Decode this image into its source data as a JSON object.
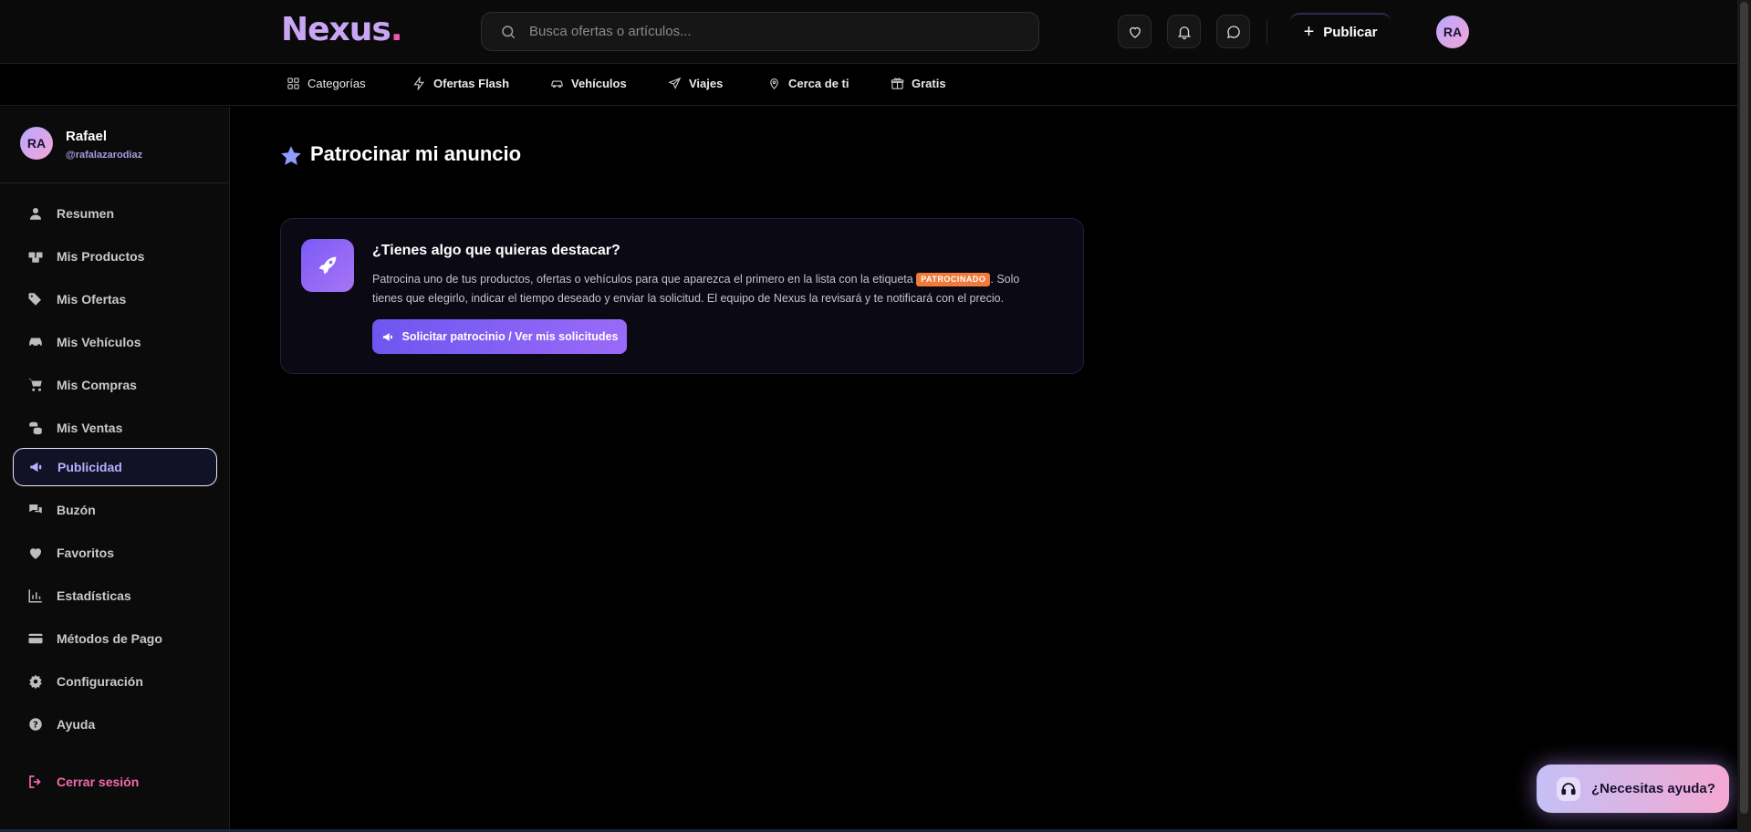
{
  "header": {
    "logo_text": "Nexus",
    "logo_dot": ".",
    "search_placeholder": "Busca ofertas o artículos...",
    "publish_label": "Publicar",
    "avatar_initials": "RA"
  },
  "categories": [
    {
      "label": "Categorías",
      "icon": "grid-icon"
    },
    {
      "label": "Ofertas Flash",
      "icon": "lightning-icon"
    },
    {
      "label": "Vehículos",
      "icon": "car-icon"
    },
    {
      "label": "Viajes",
      "icon": "plane-icon"
    },
    {
      "label": "Cerca de ti",
      "icon": "location-pin-icon"
    },
    {
      "label": "Gratis",
      "icon": "gift-icon"
    }
  ],
  "sidebar": {
    "user_initials": "RA",
    "user_name": "Rafael",
    "user_handle": "@rafalazarodiaz",
    "items": [
      {
        "label": "Resumen",
        "icon": "user-icon"
      },
      {
        "label": "Mis Productos",
        "icon": "boxes-icon"
      },
      {
        "label": "Mis Ofertas",
        "icon": "tags-icon"
      },
      {
        "label": "Mis Vehículos",
        "icon": "car-icon"
      },
      {
        "label": "Mis Compras",
        "icon": "cart-icon"
      },
      {
        "label": "Mis Ventas",
        "icon": "coins-icon"
      },
      {
        "label": "Publicidad",
        "icon": "megaphone-icon",
        "active": true
      },
      {
        "label": "Buzón",
        "icon": "chat-bubbles-icon"
      },
      {
        "label": "Favoritos",
        "icon": "heart-icon"
      },
      {
        "label": "Estadísticas",
        "icon": "bar-chart-icon"
      },
      {
        "label": "Métodos de Pago",
        "icon": "credit-card-icon"
      },
      {
        "label": "Configuración",
        "icon": "gear-icon"
      },
      {
        "label": "Ayuda",
        "icon": "question-icon"
      }
    ],
    "logout_label": "Cerrar sesión"
  },
  "main": {
    "page_title": "Patrocinar mi anuncio",
    "card": {
      "title": "¿Tienes algo que quieras destacar?",
      "text_before_badge": "Patrocina uno de tus productos, ofertas o vehículos para que aparezca el primero en la lista con la etiqueta ",
      "badge": "PATROCINADO",
      "text_after_badge": ". Solo tienes que elegirlo, indicar el tiempo deseado y enviar la solicitud. El equipo de Nexus la revisará y te notificará con el precio.",
      "button_label": "Solicitar patrocinio / Ver mis solicitudes"
    }
  },
  "help": {
    "label": "¿Necesitas ayuda?"
  },
  "colors": {
    "accent": "#7a5bf5",
    "logo": "#c9a6f5",
    "logo_dot": "#ec5aa9",
    "badge": "#f27a3a",
    "logout": "#f26aae"
  }
}
